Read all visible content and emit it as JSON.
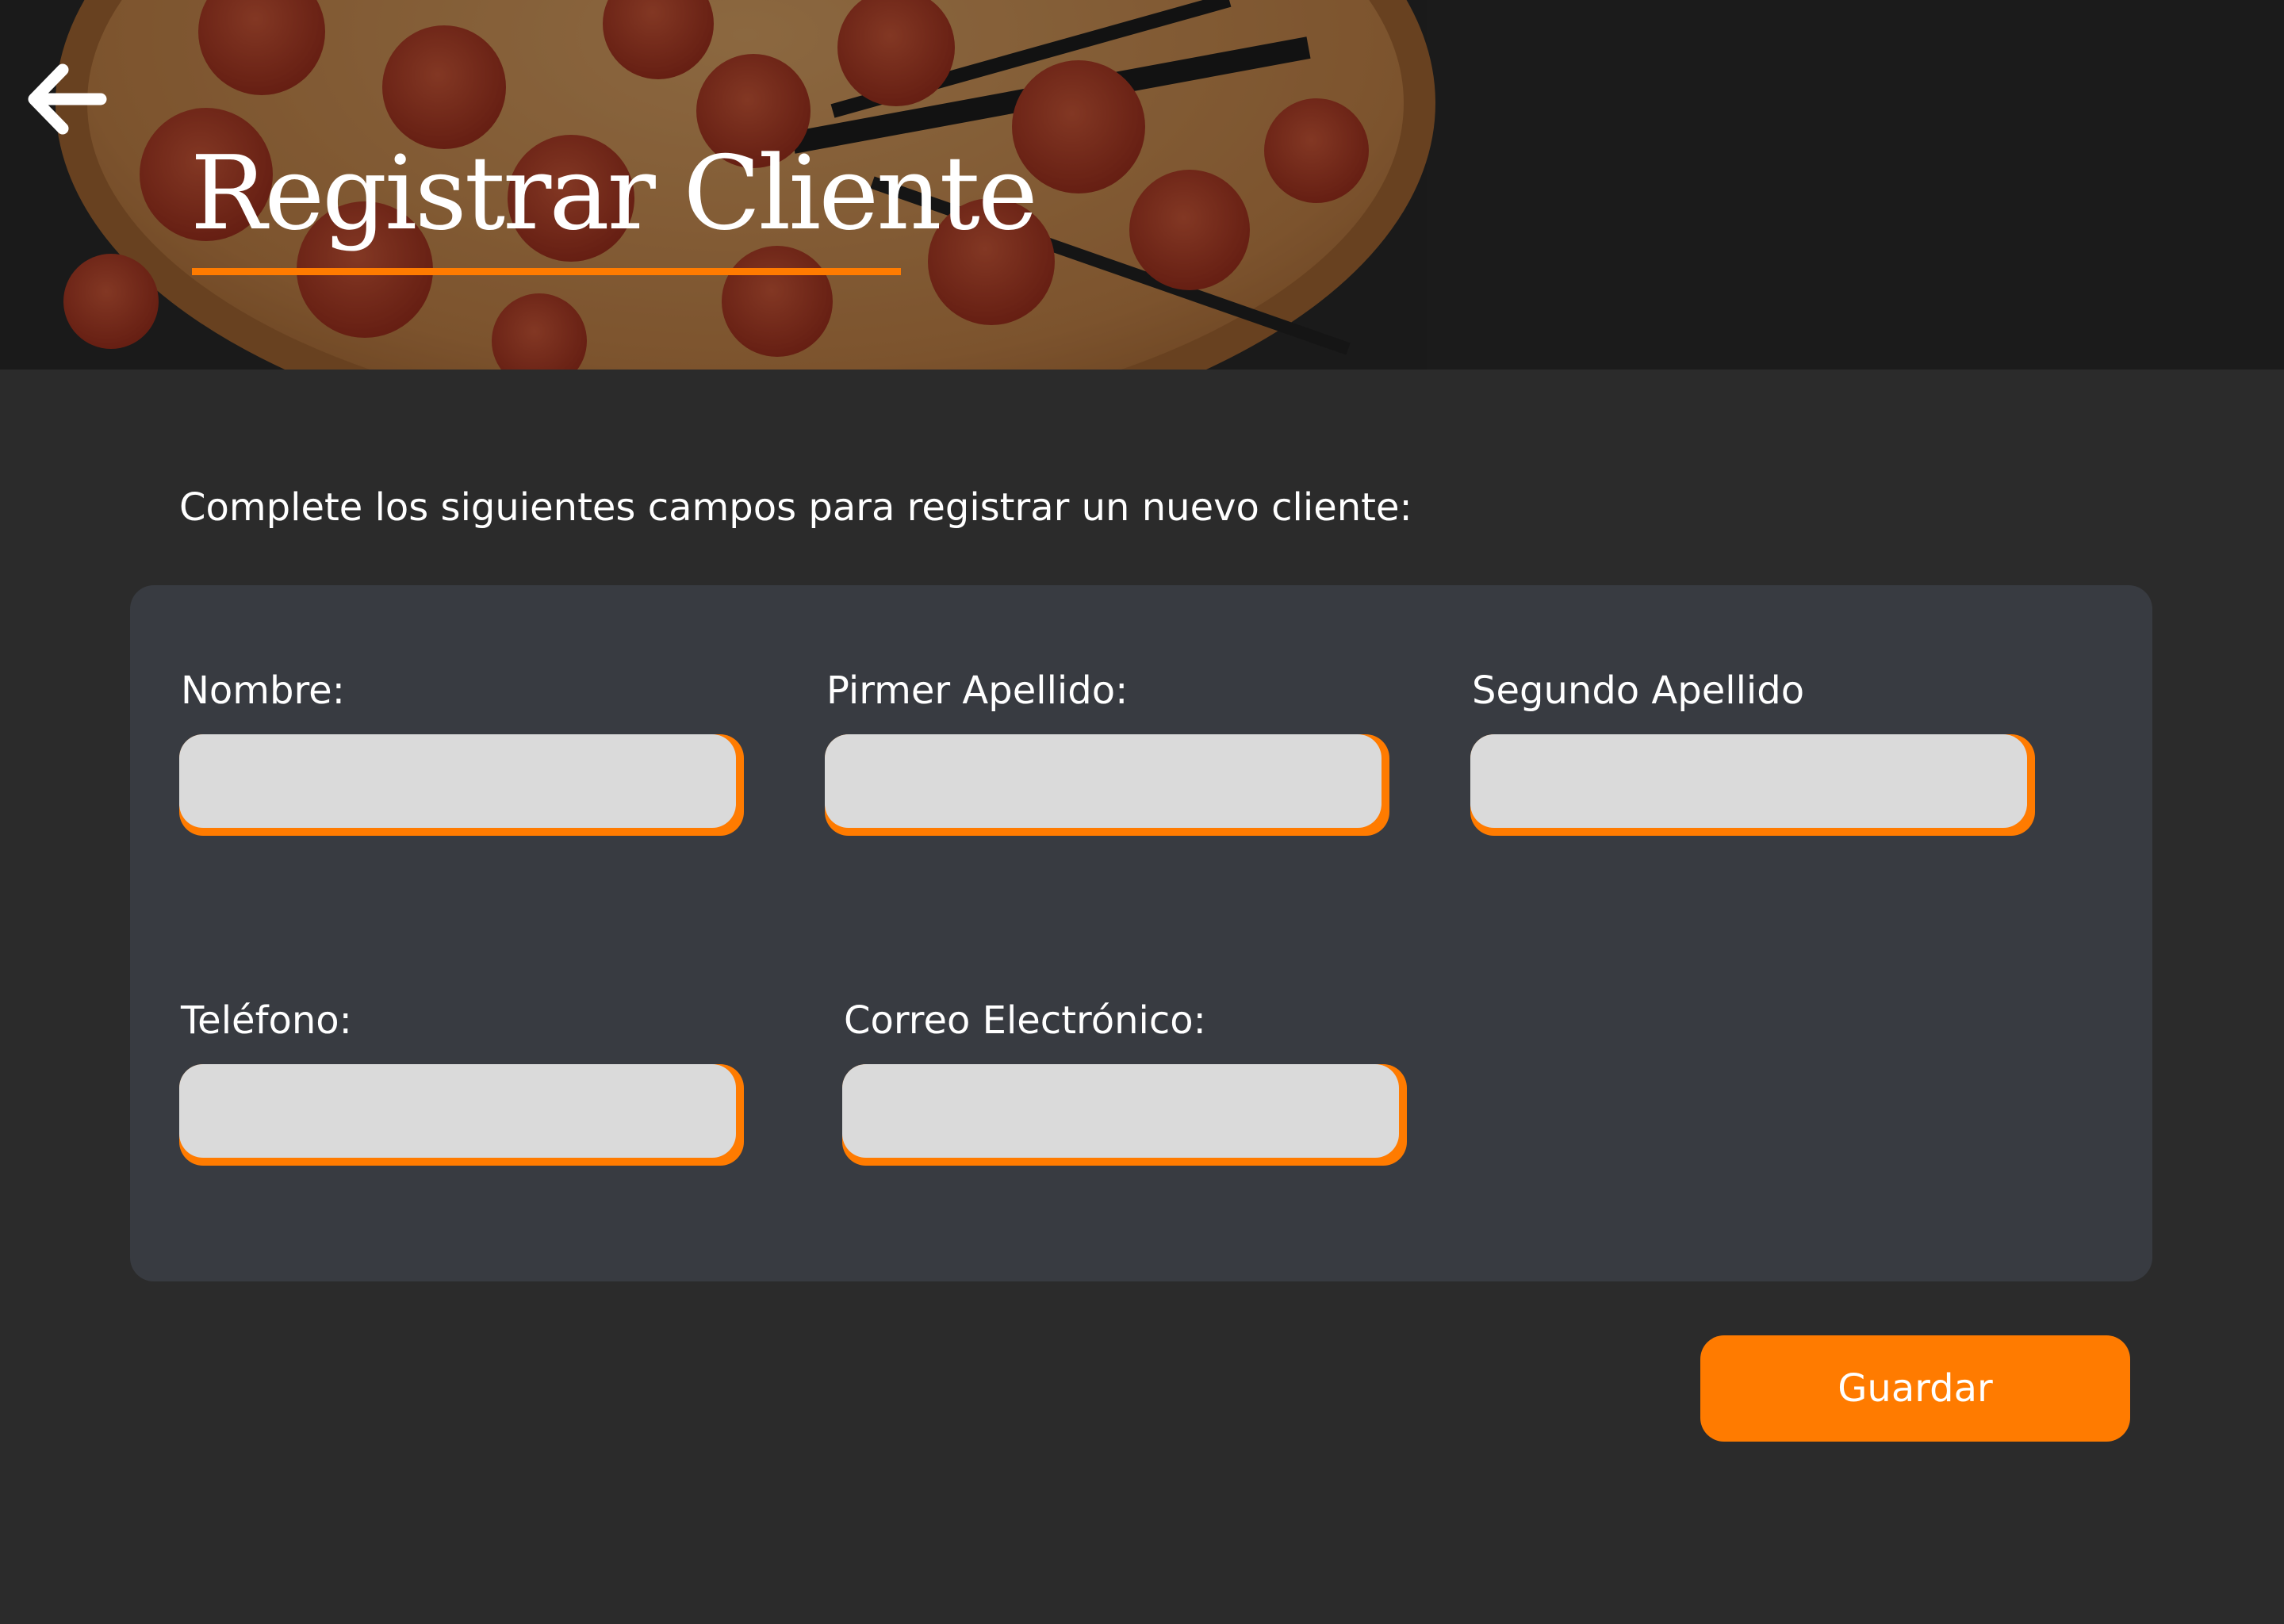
{
  "header": {
    "title": "Registrar Cliente",
    "back_icon": "arrow-left-icon",
    "background_image": "pepperoni-pizza-photo"
  },
  "instructions": "Complete los siguientes campos para registrar un nuevo cliente:",
  "form": {
    "nombre": {
      "label": "Nombre:",
      "value": ""
    },
    "primer_apellido": {
      "label": "Pirmer Apellido:",
      "value": ""
    },
    "segundo_apellido": {
      "label": "Segundo Apellido",
      "value": ""
    },
    "telefono": {
      "label": "Teléfono:",
      "value": ""
    },
    "correo": {
      "label": "Correo Electrónico:",
      "value": ""
    }
  },
  "actions": {
    "save_label": "Guardar"
  },
  "colors": {
    "accent": "#ff7b00",
    "background": "#2b2b2b",
    "panel": "#383b41",
    "input_fill": "#dadada",
    "text": "#ffffff"
  }
}
